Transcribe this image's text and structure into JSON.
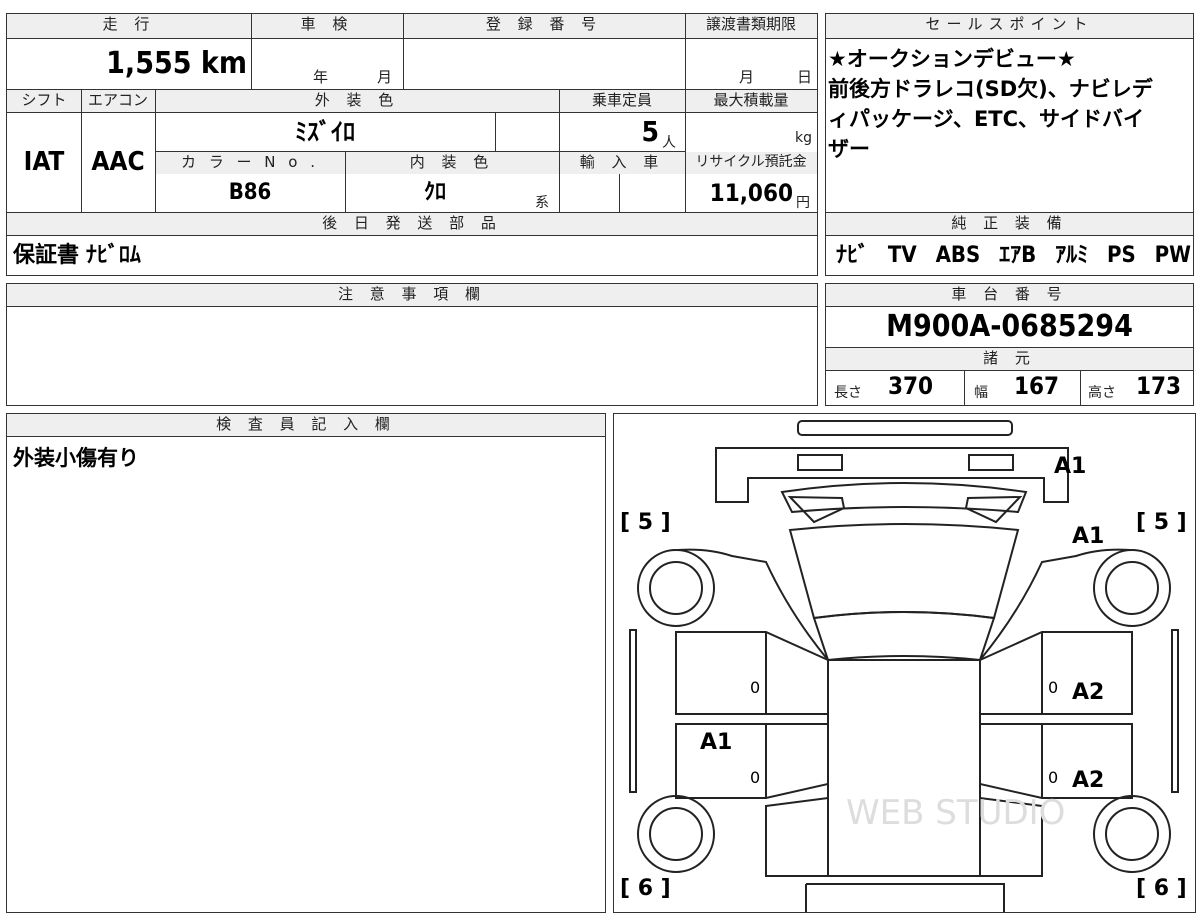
{
  "top_fragments": {
    "left": "",
    "mid": ""
  },
  "vehicle": {
    "mileage_label": "走 行",
    "mileage_value": "1,555 km",
    "inspection_label": "車 検",
    "inspection_year": "年",
    "inspection_month": "月",
    "registration_label": "登 録 番 号",
    "deadline_label": "譲渡書類期限",
    "deadline_month": "月",
    "deadline_day": "日",
    "shift_label": "シフト",
    "shift_value": "IAT",
    "aircon_label": "エアコン",
    "aircon_value": "AAC",
    "exterior_color_label": "外 装 色",
    "exterior_color_value": "ﾐｽﾞｲﾛ",
    "capacity_label": "乗車定員",
    "capacity_value": "5",
    "capacity_unit": "人",
    "max_load_label": "最大積載量",
    "max_load_unit": "kg",
    "color_no_label": "カ ラ ー N o .",
    "color_no_value": "B86",
    "interior_color_label": "内 装 色",
    "interior_color_value": "ｸﾛ",
    "interior_color_suffix": "系",
    "import_label": "輸 入 車",
    "recycle_label": "リサイクル預託金",
    "recycle_value": "11,060",
    "recycle_unit": "円",
    "later_parts_label": "後 日 発 送 部 品",
    "later_parts_value": "保証書 ﾅﾋﾞﾛﾑ"
  },
  "sales_point": {
    "label": "セールスポイント",
    "text": "★オークションデビュー★\n前後方ドラレコ(SD欠)、ナビレディパッケージ、ETC、サイドバイザー"
  },
  "genuine_equipment": {
    "label": "純 正 装 備",
    "items": [
      "ﾅﾋﾞ",
      "TV",
      "ABS",
      "ｴｱB",
      "ｱﾙﾐ",
      "PS",
      "PW"
    ]
  },
  "notes": {
    "label": "注 意 事 項 欄",
    "text": ""
  },
  "chassis": {
    "label": "車 台 番 号",
    "value": "M900A-0685294"
  },
  "specs": {
    "label": "諸 元",
    "length_label": "長さ",
    "length_value": "370",
    "width_label": "幅",
    "width_value": "167",
    "height_label": "高さ",
    "height_value": "173"
  },
  "inspector": {
    "label": "検 査 員 記 入 欄",
    "text": "外装小傷有り"
  },
  "diagram": {
    "marks": {
      "rear_bumper": "A1",
      "rear_glass": "A1",
      "left_rear_door": "A1",
      "right_rear_door": "A2",
      "right_front_door": "A2",
      "left_rear_door_zero": "0",
      "left_front_door_zero": "0",
      "right_rear_door_zero": "0",
      "right_front_door_zero": "0"
    },
    "tire_left_rear": "[ 5 ]",
    "tire_right_rear": "[ 5 ]",
    "tire_left_front": "[ 6 ]",
    "tire_right_front": "[ 6 ]",
    "watermark": "WEB STUDIO"
  }
}
